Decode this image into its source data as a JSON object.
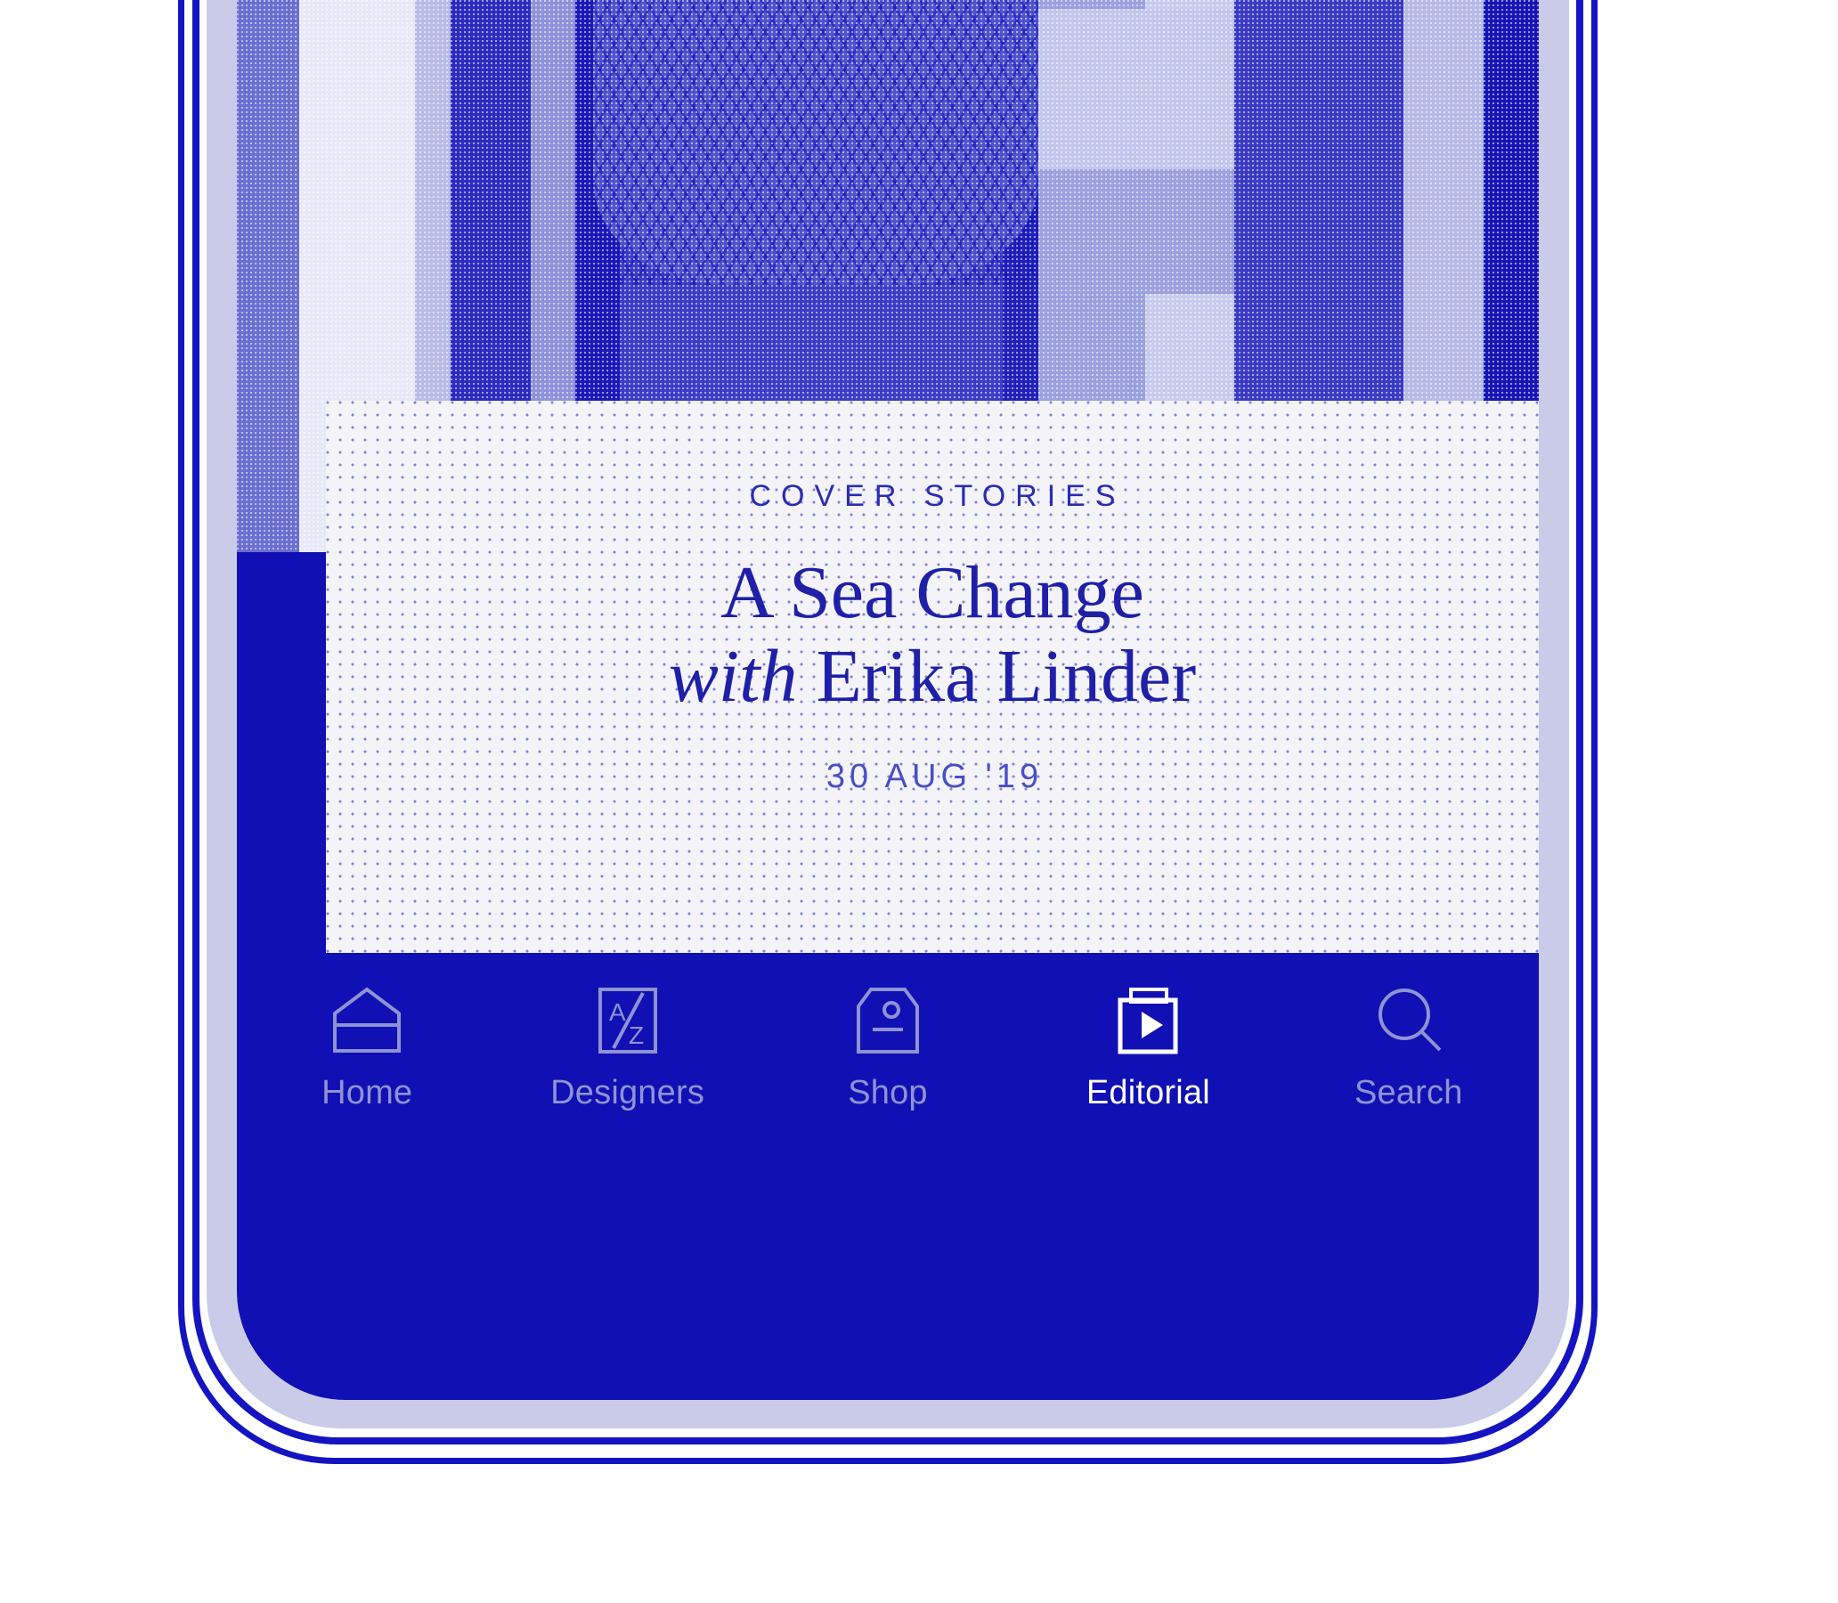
{
  "app": {
    "accent_blue": "#1010b4",
    "muted_lavender": "#8f93d4",
    "card_bg": "#f4f4f8",
    "active_color": "#ffffff"
  },
  "hero": {
    "photo_alt": "halftone duotone editorial fashion photograph"
  },
  "card": {
    "eyebrow": "COVER STORIES",
    "headline_line1": "A Sea Change",
    "headline_with": "with",
    "headline_name": "Erika Linder",
    "date": "30 AUG '19"
  },
  "tabbar": {
    "items": [
      {
        "label": "Home",
        "icon": "house-icon",
        "active": false
      },
      {
        "label": "Designers",
        "icon": "a-to-z-icon",
        "active": false
      },
      {
        "label": "Shop",
        "icon": "price-tag-icon",
        "active": false
      },
      {
        "label": "Editorial",
        "icon": "play-box-icon",
        "active": true
      },
      {
        "label": "Search",
        "icon": "magnifier-icon",
        "active": false
      }
    ]
  }
}
